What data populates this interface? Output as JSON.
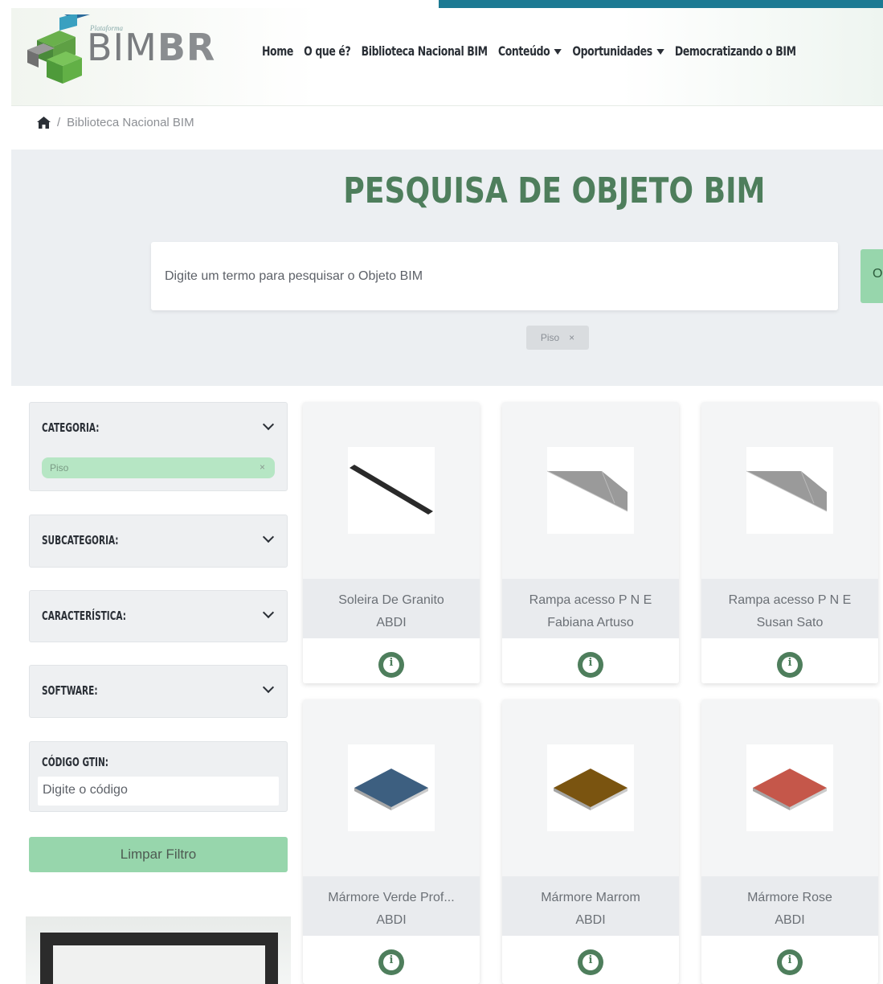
{
  "brand": {
    "small": "Plataforma",
    "name_light": "BIM",
    "name_bold": "BR"
  },
  "nav": {
    "items": [
      {
        "label": "Home",
        "dropdown": false
      },
      {
        "label": "O que é?",
        "dropdown": false
      },
      {
        "label": "Biblioteca Nacional BIM",
        "dropdown": false
      },
      {
        "label": "Conteúdo",
        "dropdown": true
      },
      {
        "label": "Oportunidades",
        "dropdown": true
      },
      {
        "label": "Democratizando o BIM",
        "dropdown": false
      }
    ]
  },
  "breadcrumb": {
    "home_icon": "home-icon",
    "separator": "/",
    "current": "Biblioteca Nacional BIM"
  },
  "search": {
    "title": "PESQUISA DE OBJETO BIM",
    "placeholder": "Digite um termo para pesquisar o Objeto BIM",
    "button_label": "O",
    "active_tag": "Piso",
    "tag_close": "×"
  },
  "filters": {
    "categoria": {
      "label": "CATEGORIA:",
      "selected": "Piso",
      "remove": "×"
    },
    "subcategoria": {
      "label": "SUBCATEGORIA:"
    },
    "caracteristica": {
      "label": "CARACTERÍSTICA:"
    },
    "software": {
      "label": "SOFTWARE:"
    },
    "gtin": {
      "label": "CÓDIGO GTIN:",
      "placeholder": "Digite o código"
    },
    "clear_label": "Limpar Filtro"
  },
  "cards": [
    {
      "name": "Soleira De Granito",
      "author": "ABDI",
      "shape": "bar",
      "color": "#2a2a2a"
    },
    {
      "name": "Rampa acesso P N E",
      "author": "Fabiana Artuso",
      "shape": "ramp",
      "color": "#9a9a9a"
    },
    {
      "name": "Rampa acesso P N E",
      "author": "Susan Sato",
      "shape": "ramp",
      "color": "#9a9a9a"
    },
    {
      "name": "Mármore Verde Prof...",
      "author": "ABDI",
      "shape": "tile",
      "color": "#3d5f80"
    },
    {
      "name": "Mármore Marrom",
      "author": "ABDI",
      "shape": "tile",
      "color": "#7a5410"
    },
    {
      "name": "Mármore Rose",
      "author": "ABDI",
      "shape": "tile",
      "color": "#c5574a"
    }
  ],
  "info_icon_text": "i",
  "colors": {
    "accent_green": "#4e7e5c",
    "light_green": "#97d6ac",
    "top_strip": "#1c7a93"
  }
}
